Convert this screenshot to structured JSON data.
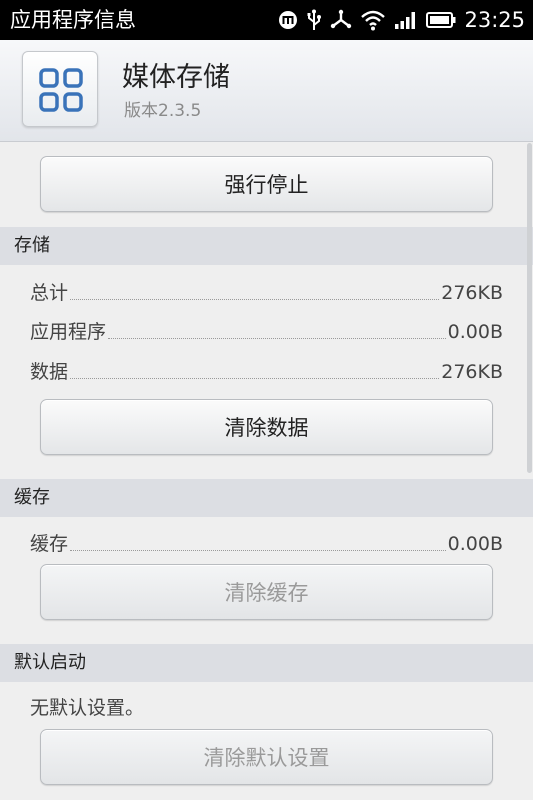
{
  "status_bar": {
    "title": "应用程序信息",
    "time": "23:25"
  },
  "app": {
    "name": "媒体存储",
    "version": "版本2.3.5",
    "icon": "app-grid-icon"
  },
  "buttons": {
    "force_stop": "强行停止",
    "clear_data": "清除数据",
    "clear_cache": "清除缓存",
    "clear_defaults": "清除默认设置"
  },
  "storage": {
    "header": "存储",
    "rows": [
      {
        "label": "总计",
        "value": "276KB"
      },
      {
        "label": "应用程序",
        "value": "0.00B"
      },
      {
        "label": "数据",
        "value": "276KB"
      }
    ]
  },
  "cache": {
    "header": "缓存",
    "rows": [
      {
        "label": "缓存",
        "value": "0.00B"
      }
    ]
  },
  "launch_default": {
    "header": "默认启动",
    "text": "无默认设置。"
  }
}
